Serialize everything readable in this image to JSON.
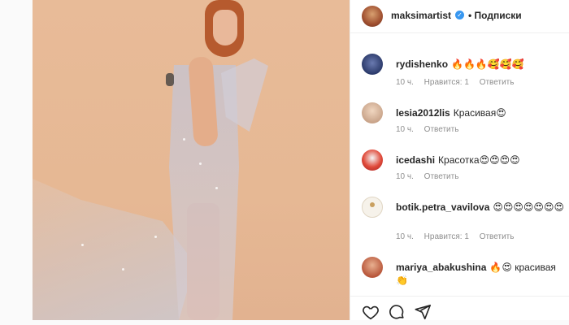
{
  "post": {
    "author": "maksimartist",
    "follow_label": "• Подписки",
    "accent": "#3897f0"
  },
  "comments": [
    {
      "user": "rydishenko",
      "text": "🔥🔥🔥🥰🥰🥰",
      "time": "10 ч.",
      "likes": "Нравится: 1",
      "reply": "Ответить",
      "avatar_color": "#2b3a6a"
    },
    {
      "user": "lesia2012lis",
      "text": "Красивая😍",
      "time": "10 ч.",
      "likes": "",
      "reply": "Ответить",
      "avatar_color": "#c9a48a"
    },
    {
      "user": "icedashi",
      "text": "Красотка😍😍😍😍",
      "time": "10 ч.",
      "likes": "",
      "reply": "Ответить",
      "avatar_color": "#c0392b"
    },
    {
      "user": "botik.petra_vavilova",
      "text": "😍😍😍😍😍😍😍",
      "time": "10 ч.",
      "likes": "Нравится: 1",
      "reply": "Ответить",
      "avatar_color": "#e9e0cf"
    },
    {
      "user": "mariya_abakushina",
      "text": "🔥😍 красивая👏",
      "time": "",
      "likes": "",
      "reply": "",
      "avatar_color": "#b8563a"
    }
  ],
  "icons": [
    "heart-icon",
    "comment-icon",
    "share-icon",
    "chevron-right-icon",
    "verified-badge-icon"
  ]
}
